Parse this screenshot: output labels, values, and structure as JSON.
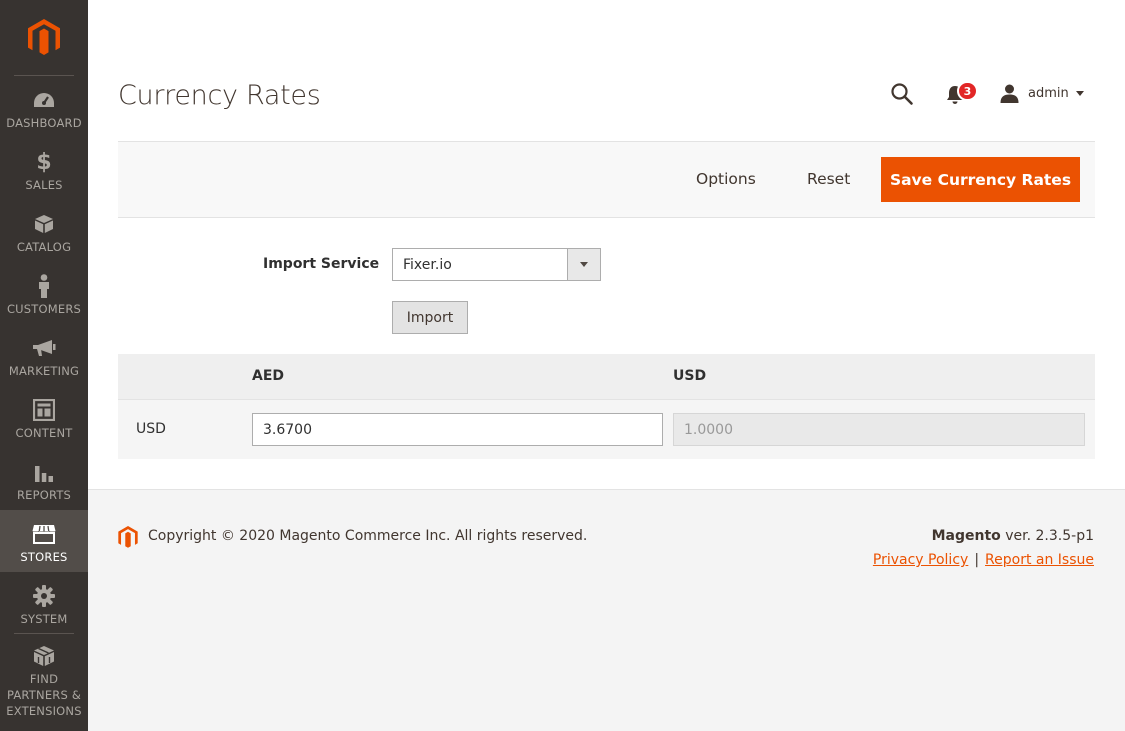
{
  "sidebar": {
    "items": [
      {
        "label": "DASHBOARD",
        "icon": "dashboard-icon"
      },
      {
        "label": "SALES",
        "icon": "dollar-icon"
      },
      {
        "label": "CATALOG",
        "icon": "box-icon"
      },
      {
        "label": "CUSTOMERS",
        "icon": "person-icon"
      },
      {
        "label": "MARKETING",
        "icon": "megaphone-icon"
      },
      {
        "label": "CONTENT",
        "icon": "layout-icon"
      },
      {
        "label": "REPORTS",
        "icon": "bar-chart-icon"
      },
      {
        "label": "STORES",
        "icon": "storefront-icon"
      },
      {
        "label": "SYSTEM",
        "icon": "gear-icon"
      },
      {
        "label_lines": [
          "FIND",
          "PARTNERS &",
          "EXTENSIONS"
        ],
        "icon": "cubes-icon"
      }
    ],
    "active": "STORES"
  },
  "header": {
    "title": "Currency Rates",
    "notifications_count": "3",
    "username": "admin"
  },
  "actions": {
    "options_label": "Options",
    "reset_label": "Reset",
    "save_label": "Save Currency Rates"
  },
  "import": {
    "label": "Import Service",
    "service_value": "Fixer.io",
    "button_label": "Import"
  },
  "rates": {
    "columns": [
      "AED",
      "USD"
    ],
    "rows": [
      {
        "currency": "USD",
        "values": [
          "3.6700",
          "1.0000"
        ]
      }
    ]
  },
  "footer": {
    "copyright": "Copyright © 2020 Magento Commerce Inc. All rights reserved.",
    "brand": "Magento",
    "version": "ver. 2.3.5-p1",
    "privacy_label": "Privacy Policy",
    "separator": "|",
    "report_label": "Report an Issue"
  },
  "colors": {
    "accent": "#eb5202",
    "sidebar_bg": "#373330",
    "badge": "#e22626"
  }
}
